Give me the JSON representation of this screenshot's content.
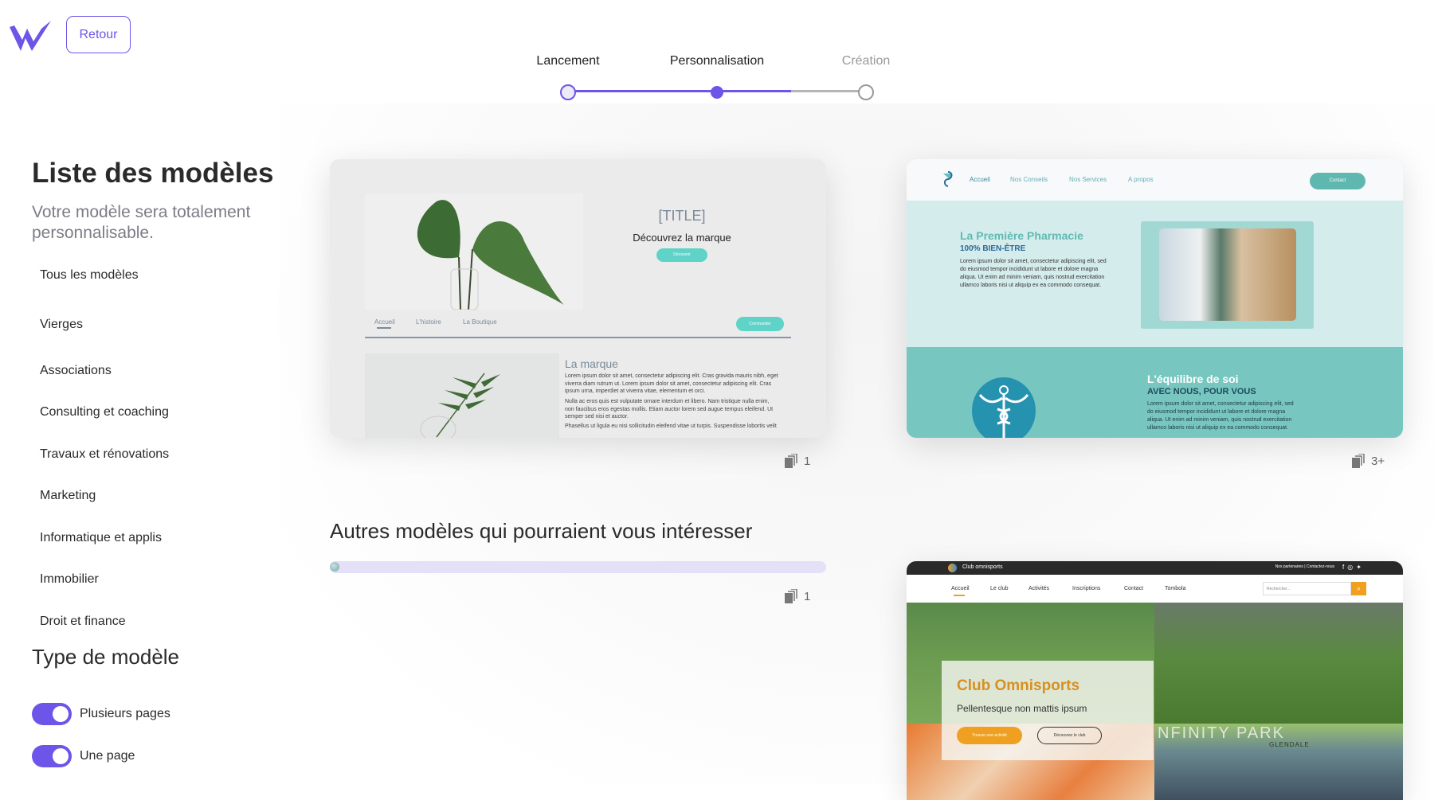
{
  "header": {
    "retour_label": "Retour",
    "accent": "#6c55e8"
  },
  "steps": [
    {
      "label": "Lancement",
      "state": "done"
    },
    {
      "label": "Personnalisation",
      "state": "active"
    },
    {
      "label": "Création",
      "state": "todo"
    }
  ],
  "sidebar": {
    "title": "Liste des modèles",
    "subtitle": "Votre modèle sera totalement personnalisable.",
    "categories": [
      "Tous les modèles",
      "Vierges",
      "Associations",
      "Consulting et coaching",
      "Travaux et rénovations",
      "Marketing",
      "Informatique et applis",
      "Immobilier",
      "Droit et finance"
    ],
    "type_title": "Type de modèle",
    "toggles": [
      {
        "label": "Plusieurs pages",
        "on": true
      },
      {
        "label": "Une page",
        "on": true
      }
    ]
  },
  "templates": [
    {
      "pages": "1",
      "preview": {
        "title": "[TITLE]",
        "subtitle": "Découvrez la marque",
        "cta": "Découvrir",
        "nav": [
          "Accueil",
          "L'histoire",
          "La Boutique"
        ],
        "order": "Commander",
        "section_title": "La marque",
        "paragraphs": [
          "Lorem ipsum dolor sit amet, consectetur adipiscing elit. Cras gravida mauris nibh, eget viverra diam rutrum ut. Lorem ipsum dolor sit amet, consectetur adipiscing elit. Cras ipsum urna, imperdiet at viverra vitae, elementum et orci.",
          "Nulla ac eros quis est vulputate ornare interdum et libero. Nam tristique nulla enim, non faucibus eros egestas mollis. Etiam auctor lorem sed augue tempus eleifend. Ut semper sed nisi et auctor.",
          "Phasellus ut ligula eu nisi sollicitudin eleifend vitae ut turpis. Suspendisse lobortis velit"
        ]
      }
    },
    {
      "pages": "3+",
      "preview": {
        "nav": [
          "Accueil",
          "Nos Conseils",
          "Nos Services",
          "A propos"
        ],
        "contact": "Contact",
        "title": "La Première Pharmacie",
        "tagline": "100% BIEN-ÊTRE",
        "paragraph": "Lorem ipsum dolor sit amet, consectetur adipiscing elit, sed do eiusmod tempor incididunt ut labore et dolore magna aliqua. Ut enim ad minim veniam, quis nostrud exercitation ullamco laboris nisi ut aliquip ex ea commodo consequat.",
        "title2": "L'équilibre de soi",
        "tagline2": "AVEC NOUS, POUR VOUS",
        "paragraph2": "Lorem ipsum dolor sit amet, consectetur adipiscing elit, sed do eiusmod tempor incididunt ut labore et dolore magna aliqua. Ut enim ad minim veniam, quis nostrud exercitation ullamco laboris nisi ut aliquip ex ea commodo consequat."
      }
    },
    {
      "preview": {
        "brand": "Club omnisports",
        "top_links": "Nos partenaires | Contactez-nous",
        "nav": [
          "Accueil",
          "Le club",
          "Activités",
          "Inscriptions",
          "Contact",
          "Tombola"
        ],
        "search_placeholder": "Rechercher...",
        "title": "Club Omnisports",
        "subtitle": "Pellentesque non mattis ipsum",
        "btn1": "Trouver une activité",
        "btn2": "Découvrez le club",
        "sign": "NFINITY PARK",
        "sign2": "GLENDALE"
      }
    }
  ],
  "others": {
    "title": "Autres modèles qui pourraient vous intéresser",
    "pages": "1"
  }
}
